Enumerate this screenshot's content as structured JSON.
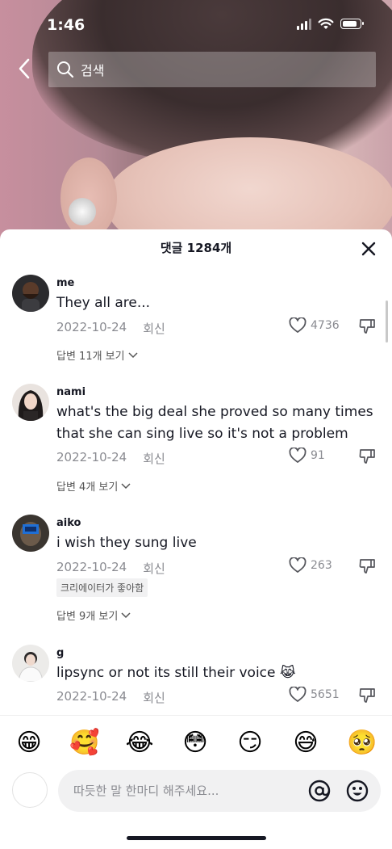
{
  "status_bar": {
    "time": "1:46"
  },
  "search": {
    "placeholder": "검색"
  },
  "sheet": {
    "title": "댓글 1284개"
  },
  "comments": [
    {
      "username": "me",
      "text": "They all are...",
      "date": "2022-10-24",
      "reply_label": "회신",
      "likes": "4736",
      "view_replies": "답변 11개 보기"
    },
    {
      "username": "nami",
      "text": "what's the big deal she proved so many times that she can sing live so it's not a problem",
      "date": "2022-10-24",
      "reply_label": "회신",
      "likes": "91",
      "view_replies": "답변 4개 보기"
    },
    {
      "username": "aiko",
      "text": "i wish they sung live",
      "date": "2022-10-24",
      "reply_label": "회신",
      "likes": "263",
      "badge": "크리에이터가 좋아함",
      "view_replies": "답변 9개 보기"
    },
    {
      "username": "g",
      "text": "lipsync or not its still their voice 😹",
      "date": "2022-10-24",
      "reply_label": "회신",
      "likes": "5651"
    }
  ],
  "emoji_bar": [
    "😁",
    "🥰",
    "😂",
    "😳",
    "😏",
    "😅",
    "🥺"
  ],
  "composer": {
    "placeholder": "따듯한 말 한마디 해주세요..."
  }
}
